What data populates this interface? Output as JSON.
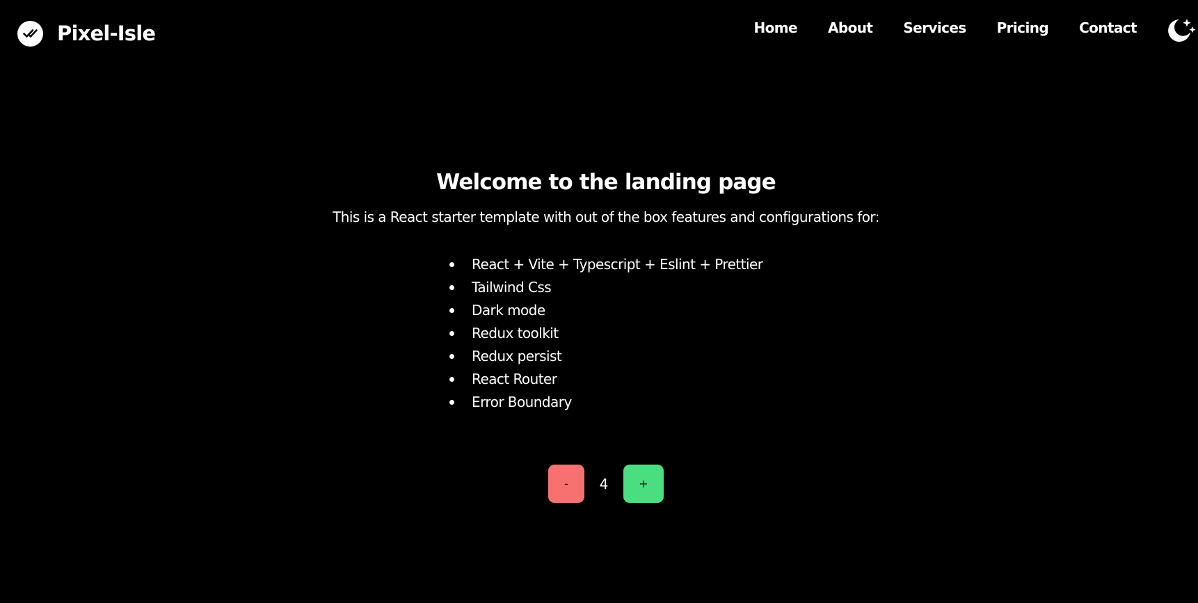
{
  "colors": {
    "background": "#000000",
    "text": "#ffffff",
    "decrement_button": "#f87171",
    "increment_button": "#4ade80"
  },
  "header": {
    "brand": {
      "name": "Pixel-Isle",
      "logo_icon": "double-check-circle-icon"
    },
    "nav": [
      {
        "label": "Home"
      },
      {
        "label": "About"
      },
      {
        "label": "Services"
      },
      {
        "label": "Pricing"
      },
      {
        "label": "Contact"
      }
    ],
    "theme_toggle_icon": "moon-sparkles-icon"
  },
  "main": {
    "title": "Welcome to the landing page",
    "description": "This is a React starter template with out of the box features and configurations for:",
    "features": [
      "React + Vite + Typescript + Eslint + Prettier",
      "Tailwind Css",
      "Dark mode",
      "Redux toolkit",
      "Redux persist",
      "React Router",
      "Error Boundary"
    ],
    "counter": {
      "decrement_label": "-",
      "value": "4",
      "increment_label": "+"
    }
  }
}
